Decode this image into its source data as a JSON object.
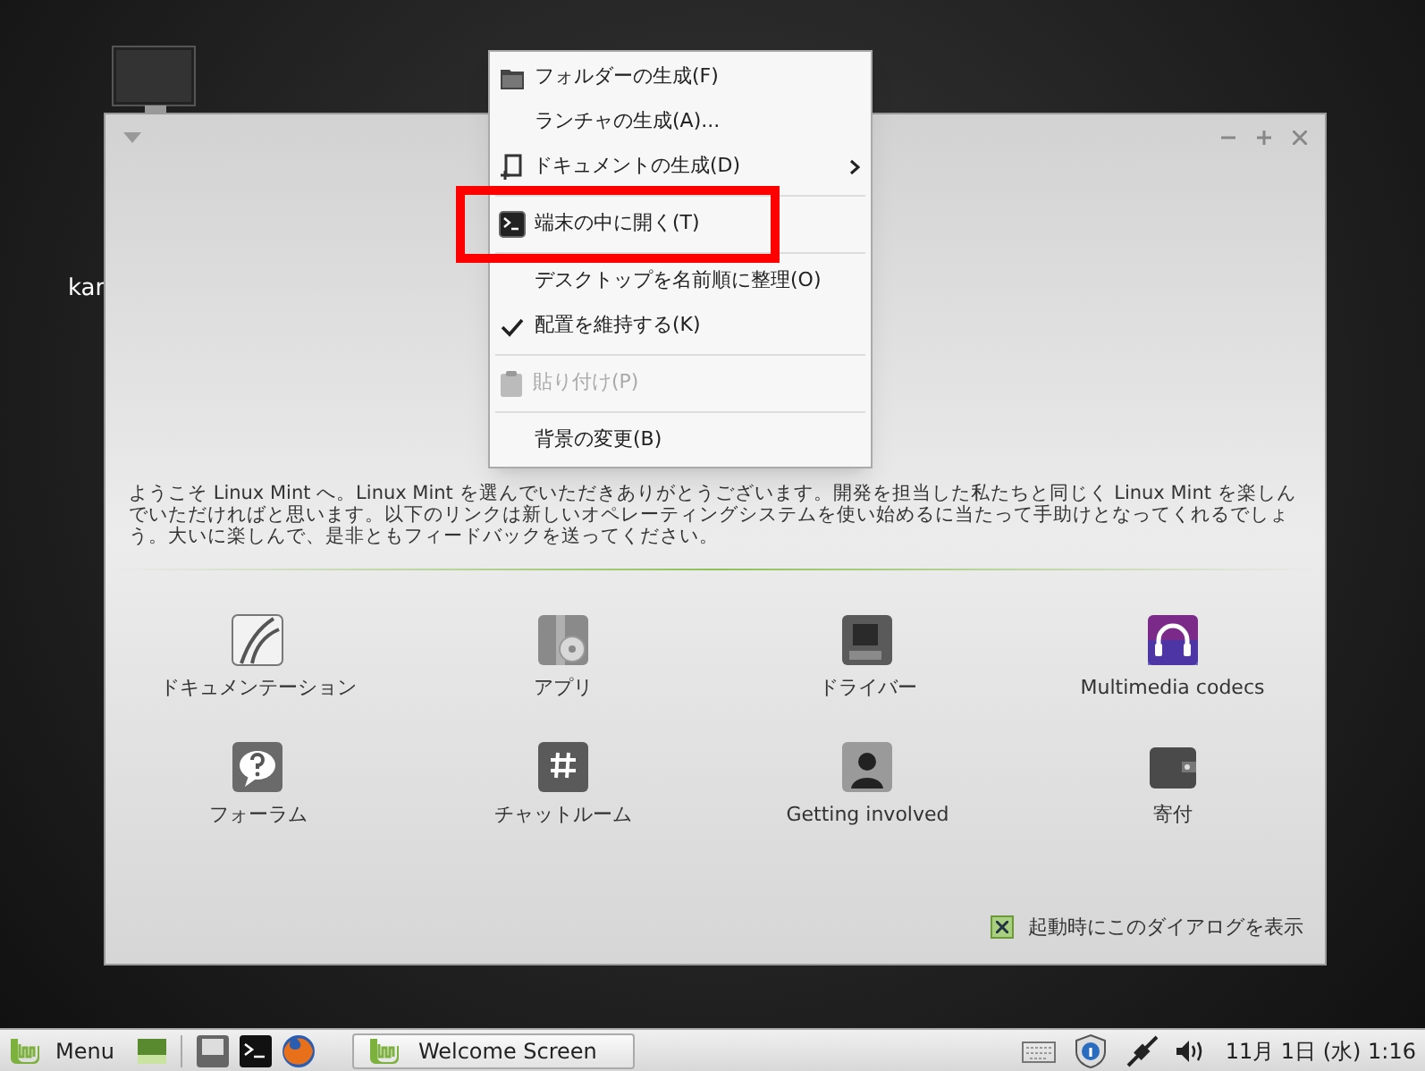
{
  "desktop": {
    "icon_label": "kar"
  },
  "window": {
    "intro": "ようこそ Linux Mint へ。Linux Mint を選んでいただきありがとうございます。開発を担当した私たちと同じく Linux Mint を楽しんでいただければと思います。以下のリンクは新しいオペレーティングシステムを使い始めるに当たって手助けとなってくれるでしょう。大いに楽しんで、是非ともフィードバックを送ってください。",
    "links": [
      {
        "label": "ドキュメンテーション",
        "kind": "docs"
      },
      {
        "label": "アプリ",
        "kind": "apps"
      },
      {
        "label": "ドライバー",
        "kind": "drivers"
      },
      {
        "label": "Multimedia codecs",
        "kind": "codecs"
      },
      {
        "label": "フォーラム",
        "kind": "forum"
      },
      {
        "label": "チャットルーム",
        "kind": "chat"
      },
      {
        "label": "Getting involved",
        "kind": "involved"
      },
      {
        "label": "寄付",
        "kind": "donate"
      }
    ],
    "startup_checkbox": {
      "label": "起動時にこのダイアログを表示",
      "checked": true
    }
  },
  "context_menu": [
    {
      "kind": "folder",
      "label": "フォルダーの生成(F)",
      "disabled": false,
      "checked": false,
      "submenu": false,
      "highlighted": false
    },
    {
      "kind": "item",
      "label": "ランチャの生成(A)...",
      "disabled": false,
      "checked": false,
      "submenu": false,
      "highlighted": false
    },
    {
      "kind": "document",
      "label": "ドキュメントの生成(D)",
      "disabled": false,
      "checked": false,
      "submenu": true,
      "highlighted": false
    },
    {
      "kind": "separator"
    },
    {
      "kind": "terminal",
      "label": "端末の中に開く(T)",
      "disabled": false,
      "checked": false,
      "submenu": false,
      "highlighted": true
    },
    {
      "kind": "separator"
    },
    {
      "kind": "item",
      "label": "デスクトップを名前順に整理(O)",
      "disabled": false,
      "checked": false,
      "submenu": false,
      "highlighted": false
    },
    {
      "kind": "item",
      "label": "配置を維持する(K)",
      "disabled": false,
      "checked": true,
      "submenu": false,
      "highlighted": false
    },
    {
      "kind": "separator"
    },
    {
      "kind": "clipboard",
      "label": "貼り付け(P)",
      "disabled": true,
      "checked": false,
      "submenu": false,
      "highlighted": false
    },
    {
      "kind": "separator"
    },
    {
      "kind": "item",
      "label": "背景の変更(B)",
      "disabled": false,
      "checked": false,
      "submenu": false,
      "highlighted": false
    }
  ],
  "taskbar": {
    "menu_label": "Menu",
    "window_button": "Welcome Screen",
    "clock": "11月 1日 (水) 1:16"
  }
}
